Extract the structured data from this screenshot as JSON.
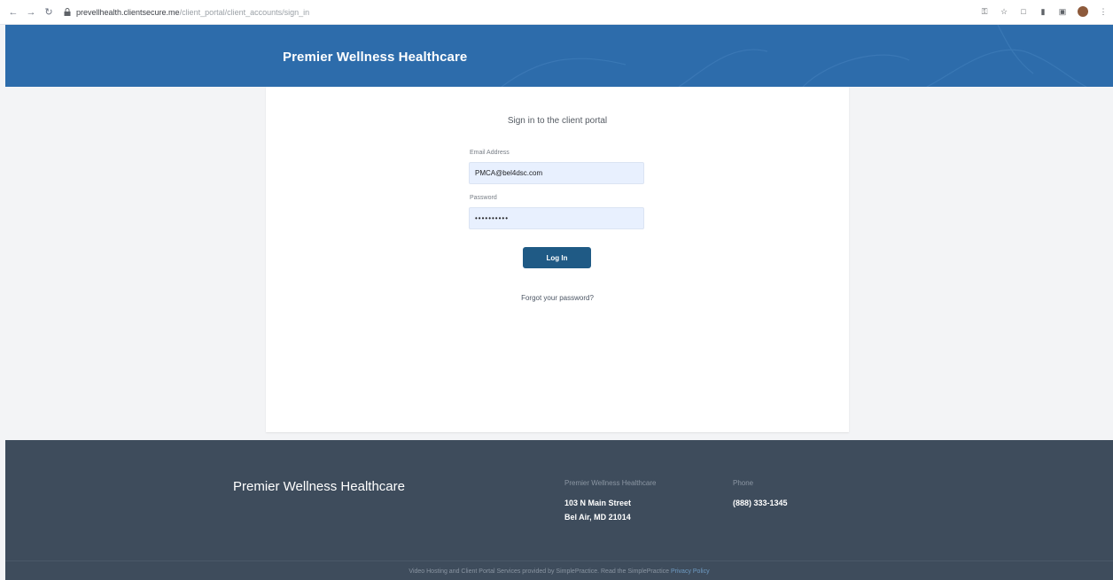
{
  "browser": {
    "url_host": "prevellhealth.clientsecure.me",
    "url_path": "/client_portal/client_accounts/sign_in"
  },
  "header": {
    "brand": "Premier Wellness Healthcare"
  },
  "login": {
    "title": "Sign in to the client portal",
    "email_label": "Email Address",
    "email_value": "PMCA@bel4dsc.com",
    "password_label": "Password",
    "password_value": "••••••••••",
    "login_button": "Log In",
    "forgot_link": "Forgot your password?"
  },
  "footer": {
    "brand": "Premier Wellness Healthcare",
    "address_heading": "Premier Wellness Healthcare",
    "address_line1": "103 N Main Street",
    "address_line2": "Bel Air, MD 21014",
    "phone_heading": "Phone",
    "phone": "(888) 333-1345",
    "legal_text": "Video Hosting and Client Portal Services provided by SimplePractice. Read the SimplePractice",
    "legal_link": "Privacy Policy"
  },
  "colors": {
    "header_bg": "#2d6cab",
    "button_bg": "#1f5a85",
    "footer_bg": "#3e4c5c",
    "input_bg": "#e8f0fe"
  }
}
